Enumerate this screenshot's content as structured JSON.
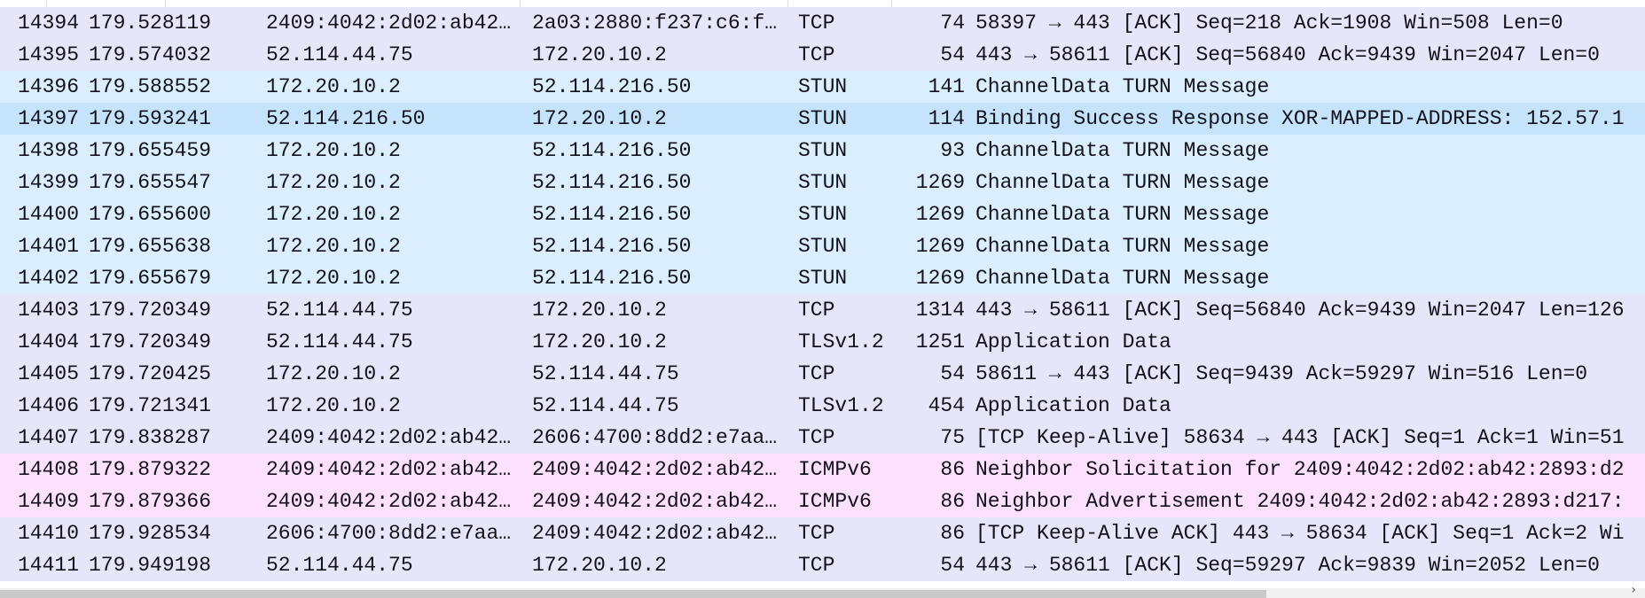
{
  "colors": {
    "TCP": "#e6e6fa",
    "STUN": "#daeefd",
    "STUN_selected": "#c5e3fb",
    "ICMPv6": "#fce0fd",
    "TLSv1.2": "#e6e6fa"
  },
  "packets": [
    {
      "no": "14394",
      "time": "179.528119",
      "src": "2409:4042:2d02:ab42…",
      "dst": "2a03:2880:f237:c6:f…",
      "proto": "TCP",
      "len": "74",
      "info": "58397 → 443 [ACK] Seq=218 Ack=1908 Win=508 Len=0",
      "color": "#e6e6fa"
    },
    {
      "no": "14395",
      "time": "179.574032",
      "src": "52.114.44.75",
      "dst": "172.20.10.2",
      "proto": "TCP",
      "len": "54",
      "info": "443 → 58611 [ACK] Seq=56840 Ack=9439 Win=2047 Len=0",
      "color": "#e6e6fa"
    },
    {
      "no": "14396",
      "time": "179.588552",
      "src": "172.20.10.2",
      "dst": "52.114.216.50",
      "proto": "STUN",
      "len": "141",
      "info": "ChannelData TURN Message",
      "color": "#daeefd"
    },
    {
      "no": "14397",
      "time": "179.593241",
      "src": "52.114.216.50",
      "dst": "172.20.10.2",
      "proto": "STUN",
      "len": "114",
      "info": "Binding Success Response XOR-MAPPED-ADDRESS: 152.57.1",
      "color": "#c5e3fb"
    },
    {
      "no": "14398",
      "time": "179.655459",
      "src": "172.20.10.2",
      "dst": "52.114.216.50",
      "proto": "STUN",
      "len": "93",
      "info": "ChannelData TURN Message",
      "color": "#daeefd"
    },
    {
      "no": "14399",
      "time": "179.655547",
      "src": "172.20.10.2",
      "dst": "52.114.216.50",
      "proto": "STUN",
      "len": "1269",
      "info": "ChannelData TURN Message",
      "color": "#daeefd"
    },
    {
      "no": "14400",
      "time": "179.655600",
      "src": "172.20.10.2",
      "dst": "52.114.216.50",
      "proto": "STUN",
      "len": "1269",
      "info": "ChannelData TURN Message",
      "color": "#daeefd"
    },
    {
      "no": "14401",
      "time": "179.655638",
      "src": "172.20.10.2",
      "dst": "52.114.216.50",
      "proto": "STUN",
      "len": "1269",
      "info": "ChannelData TURN Message",
      "color": "#daeefd"
    },
    {
      "no": "14402",
      "time": "179.655679",
      "src": "172.20.10.2",
      "dst": "52.114.216.50",
      "proto": "STUN",
      "len": "1269",
      "info": "ChannelData TURN Message",
      "color": "#daeefd"
    },
    {
      "no": "14403",
      "time": "179.720349",
      "src": "52.114.44.75",
      "dst": "172.20.10.2",
      "proto": "TCP",
      "len": "1314",
      "info": "443 → 58611 [ACK] Seq=56840 Ack=9439 Win=2047 Len=126",
      "color": "#e6e6fa"
    },
    {
      "no": "14404",
      "time": "179.720349",
      "src": "52.114.44.75",
      "dst": "172.20.10.2",
      "proto": "TLSv1.2",
      "len": "1251",
      "info": "Application Data",
      "color": "#e6e6fa"
    },
    {
      "no": "14405",
      "time": "179.720425",
      "src": "172.20.10.2",
      "dst": "52.114.44.75",
      "proto": "TCP",
      "len": "54",
      "info": "58611 → 443 [ACK] Seq=9439 Ack=59297 Win=516 Len=0",
      "color": "#e6e6fa"
    },
    {
      "no": "14406",
      "time": "179.721341",
      "src": "172.20.10.2",
      "dst": "52.114.44.75",
      "proto": "TLSv1.2",
      "len": "454",
      "info": "Application Data",
      "color": "#e6e6fa"
    },
    {
      "no": "14407",
      "time": "179.838287",
      "src": "2409:4042:2d02:ab42…",
      "dst": "2606:4700:8dd2:e7aa…",
      "proto": "TCP",
      "len": "75",
      "info": "[TCP Keep-Alive] 58634 → 443 [ACK] Seq=1 Ack=1 Win=51",
      "color": "#e6e6fa"
    },
    {
      "no": "14408",
      "time": "179.879322",
      "src": "2409:4042:2d02:ab42…",
      "dst": "2409:4042:2d02:ab42…",
      "proto": "ICMPv6",
      "len": "86",
      "info": "Neighbor Solicitation for 2409:4042:2d02:ab42:2893:d2",
      "color": "#fce0fd"
    },
    {
      "no": "14409",
      "time": "179.879366",
      "src": "2409:4042:2d02:ab42…",
      "dst": "2409:4042:2d02:ab42…",
      "proto": "ICMPv6",
      "len": "86",
      "info": "Neighbor Advertisement 2409:4042:2d02:ab42:2893:d217:",
      "color": "#fce0fd"
    },
    {
      "no": "14410",
      "time": "179.928534",
      "src": "2606:4700:8dd2:e7aa…",
      "dst": "2409:4042:2d02:ab42…",
      "proto": "TCP",
      "len": "86",
      "info": "[TCP Keep-Alive ACK] 443 → 58634 [ACK] Seq=1 Ack=2 Wi",
      "color": "#e6e6fa"
    },
    {
      "no": "14411",
      "time": "179.949198",
      "src": "52.114.44.75",
      "dst": "172.20.10.2",
      "proto": "TCP",
      "len": "54",
      "info": "443 → 58611 [ACK] Seq=59297 Ack=9839 Win=2052 Len=0",
      "color": "#e6e6fa"
    }
  ],
  "scrollbar": {
    "arrow": "›"
  }
}
